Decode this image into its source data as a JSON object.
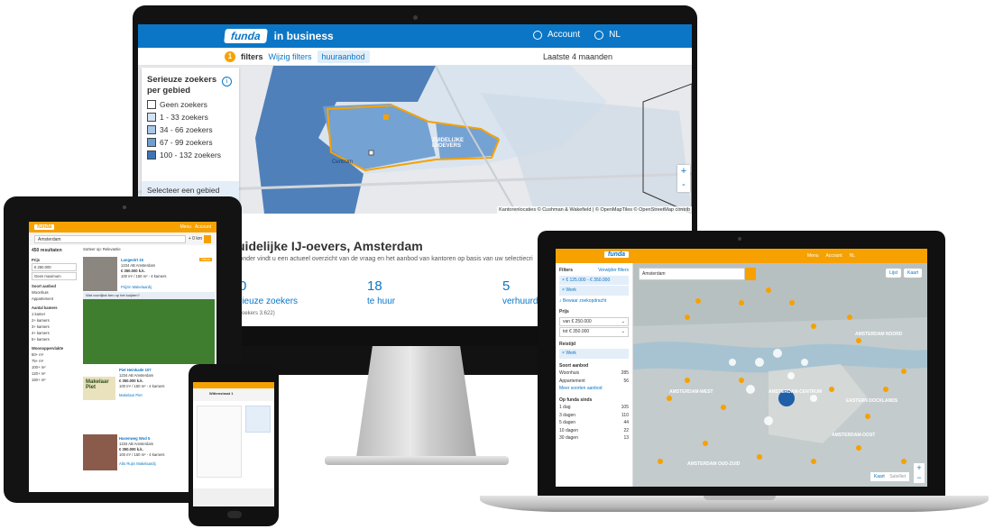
{
  "desktop": {
    "brand": {
      "logo": "funda",
      "sub": "in business"
    },
    "account": "Account",
    "language": "NL",
    "filter_count": "1",
    "filters_label": "filters",
    "edit_filters": "Wijzig filters",
    "active_filter": "huuraanbod",
    "period": "Laatste 4 maanden",
    "legend": {
      "title": "Serieuze zoekers per gebied",
      "items": [
        {
          "label": "Geen zoekers",
          "color": "#ffffff"
        },
        {
          "label": "1 - 33 zoekers",
          "color": "#d4e3f2"
        },
        {
          "label": "34 - 66 zoekers",
          "color": "#a9c7e6"
        },
        {
          "label": "67 - 99 zoekers",
          "color": "#6f9ed1"
        },
        {
          "label": "100 - 132 zoekers",
          "color": "#3f74b4"
        }
      ],
      "footer": "Selecteer een gebied voor meer informatie"
    },
    "map_labels": {
      "area": "ZUIDELIJKE IJ-OEVERS",
      "district": "Centrum"
    },
    "attribution": "Kantorenlocaties © Cushman & Wakefield | © OpenMapTiles © OpenStreetMap contrib",
    "zoom_in": "+",
    "zoom_out": "-",
    "detail": {
      "title": "uidelijke IJ-oevers, Amsterdam",
      "subtitle": "ronder vindt u een actueel overzicht van de vraag en het aanbod van kantoren op basis van uw selectiecri",
      "stats": [
        {
          "value": "0",
          "label": "rieuze zoekers"
        },
        {
          "value": "18",
          "label": "te huur"
        },
        {
          "value": "5",
          "label": "verhuurd"
        }
      ],
      "footnote": "zoekers 3.622)"
    }
  },
  "tablet": {
    "logo": "funda",
    "menu": "Menu",
    "account": "Account",
    "search_value": "Amsterdam",
    "radius": "+ 0 km",
    "results": "450 resultaten",
    "sort": "Sorteer op: Relevantie",
    "price_label": "Prijs",
    "price_from": "€ 250.000",
    "price_to": "Geen maximum",
    "type_label": "Soort aanbod",
    "types": [
      "Woonhuis",
      "Appartement"
    ],
    "rooms_label": "Aantal kamers",
    "rooms": [
      "1 kamer",
      "2+ kamers",
      "3+ kamers",
      "4+ kamers",
      "5+ kamers"
    ],
    "area_label": "Woonoppervlakte",
    "areas": [
      "50+ m²",
      "75+ m²",
      "100+ m²",
      "120+ m²",
      "150+ m²"
    ],
    "listings": [
      {
        "street": "Langestrt 15",
        "city": "1234 AB Amsterdam",
        "price": "€ 350.000 k.k.",
        "meta": "100 m² / 150 m² - 4 kamers",
        "agent": "Prijzin Makelaardij",
        "tag": "Nieuw"
      },
      {
        "street": "Piet Heinkade 107",
        "city": "1234 AB Amsterdam",
        "price": "€ 350.000 k.k.",
        "meta": "100 m² / 150 m² - 4 kamers",
        "agent": "Makelaar Piet"
      },
      {
        "street": "Hasenweg Wod 5",
        "city": "1234 AB Amsterdam",
        "price": "€ 350.000 k.k.",
        "meta": "100 m² / 150 m² - 4 kamers",
        "agent": "Atlo Rujin Makelaardij"
      }
    ],
    "ad_banner": "Wat voorlijkst ben op het kuijden?",
    "ad_text": "Makelaar Piet"
  },
  "laptop": {
    "logo": "funda",
    "menu": "Menu",
    "account": "Account",
    "language": "NL",
    "filters_title": "Filters",
    "reset_filters": "Verwijder filters",
    "chips": [
      "€ 125.000 - € 350.000",
      "Werk"
    ],
    "save_search": "Bewaar zoekopdracht",
    "price_label": "Prijs",
    "price_from": "van € 250.000",
    "price_to": "tot € 350.000",
    "travel_label": "Reistijd",
    "travel_chip": "Werk",
    "type_label": "Soort aanbod",
    "types": [
      {
        "label": "Woonhuis",
        "count": "285"
      },
      {
        "label": "Appartement",
        "count": "56"
      }
    ],
    "more_types": "Meer soorten aanbod",
    "since_label": "Op funda sinds",
    "since": [
      {
        "label": "1 dag",
        "count": "105"
      },
      {
        "label": "3 dagen",
        "count": "110"
      },
      {
        "label": "5 dagen",
        "count": "44"
      },
      {
        "label": "10 dagen",
        "count": "22"
      },
      {
        "label": "30 dagen",
        "count": "13"
      }
    ],
    "search_value": "Amsterdam",
    "tool_list": "Lijst",
    "tool_map": "Kaart",
    "toggle": [
      "Kaart",
      "Satelliet"
    ],
    "map_labels": [
      "AMSTERDAM-WEST",
      "AMSTERDAM-CENTRUM",
      "EASTERN DOCKLANDS",
      "AMSTERDAM NOORD",
      "AMSTERDAM OUD-ZUID",
      "AMSTERDAM-OOST"
    ]
  },
  "phone": {
    "heading": "Wittenstraat 1"
  }
}
